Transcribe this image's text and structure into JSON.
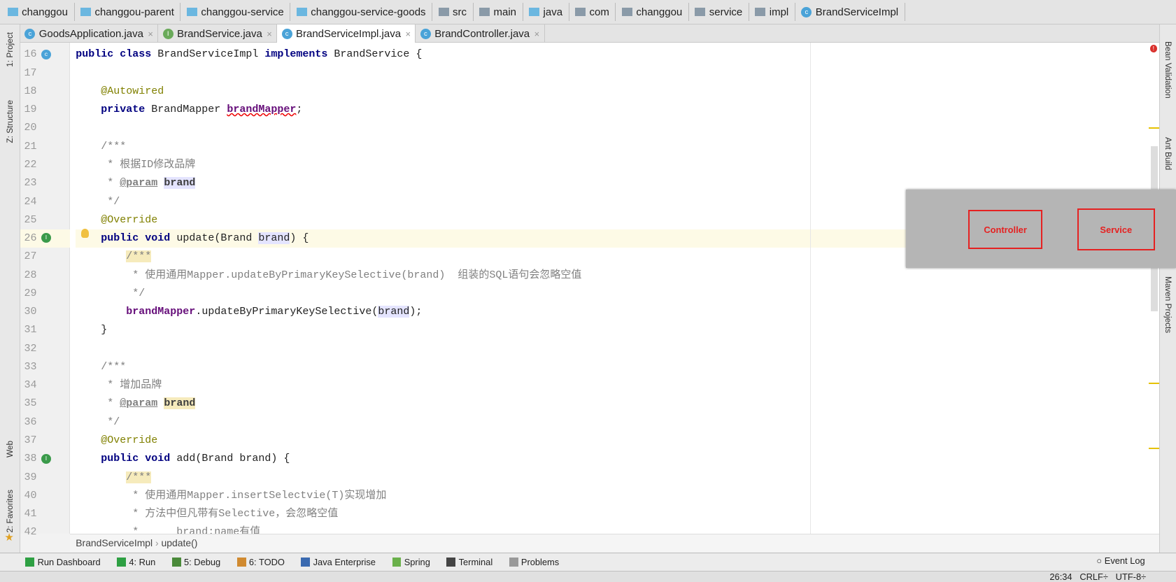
{
  "breadcrumb": [
    {
      "label": "changgou",
      "icon": "module-folder"
    },
    {
      "label": "changgou-parent",
      "icon": "module-folder"
    },
    {
      "label": "changgou-service",
      "icon": "module-folder"
    },
    {
      "label": "changgou-service-goods",
      "icon": "module-folder"
    },
    {
      "label": "src",
      "icon": "folder"
    },
    {
      "label": "main",
      "icon": "folder"
    },
    {
      "label": "java",
      "icon": "source-folder"
    },
    {
      "label": "com",
      "icon": "package"
    },
    {
      "label": "changgou",
      "icon": "package"
    },
    {
      "label": "service",
      "icon": "package"
    },
    {
      "label": "impl",
      "icon": "package"
    },
    {
      "label": "BrandServiceImpl",
      "icon": "class"
    }
  ],
  "tabs": [
    {
      "label": "GoodsApplication.java",
      "icon": "spring-boot-class",
      "active": false,
      "color": "#4aa3d8"
    },
    {
      "label": "BrandService.java",
      "icon": "interface",
      "active": false,
      "color": "#6aaa5a"
    },
    {
      "label": "BrandServiceImpl.java",
      "icon": "class",
      "active": true,
      "color": "#4aa3d8"
    },
    {
      "label": "BrandController.java",
      "icon": "class",
      "active": false,
      "color": "#4aa3d8"
    }
  ],
  "left_tools": {
    "project": "1: Project",
    "structure": "Z: Structure",
    "web": "Web",
    "favorites": "2: Favorites"
  },
  "right_tools": {
    "bean": "Bean Validation",
    "ant": "Ant Build",
    "maven": "Maven Projects"
  },
  "code": [
    {
      "n": "16",
      "tokens": [
        [
          "kw",
          "public class "
        ],
        [
          "",
          "BrandServiceImpl "
        ],
        [
          "kw",
          "implements "
        ],
        [
          "",
          "BrandService {"
        ]
      ]
    },
    {
      "n": "17",
      "tokens": []
    },
    {
      "n": "18",
      "tokens": [
        [
          "",
          "    "
        ],
        [
          "an",
          "@Autowired"
        ]
      ]
    },
    {
      "n": "19",
      "tokens": [
        [
          "",
          "    "
        ],
        [
          "kw",
          "private "
        ],
        [
          "",
          "BrandMapper "
        ],
        [
          "fld err",
          "brandMapper"
        ],
        [
          "",
          ";"
        ]
      ]
    },
    {
      "n": "20",
      "tokens": []
    },
    {
      "n": "21",
      "tokens": [
        [
          "",
          "    "
        ],
        [
          "cm",
          "/***"
        ]
      ]
    },
    {
      "n": "22",
      "tokens": [
        [
          "cm",
          "     * 根据ID修改品牌"
        ]
      ]
    },
    {
      "n": "23",
      "tokens": [
        [
          "cm",
          "     * "
        ],
        [
          "cmt",
          "@param"
        ],
        [
          "cm",
          " "
        ],
        [
          "cmb hl",
          "brand"
        ]
      ]
    },
    {
      "n": "24",
      "tokens": [
        [
          "cm",
          "     */"
        ]
      ]
    },
    {
      "n": "25",
      "tokens": [
        [
          "",
          "    "
        ],
        [
          "an",
          "@Override"
        ]
      ]
    },
    {
      "n": "26",
      "tokens": [
        [
          "",
          "    "
        ],
        [
          "kw",
          "public void "
        ],
        [
          "",
          "update(Brand "
        ],
        [
          "hl",
          "brand"
        ],
        [
          "",
          ") {"
        ]
      ],
      "current": true
    },
    {
      "n": "27",
      "tokens": [
        [
          "",
          "        "
        ],
        [
          "cm hy",
          "/***"
        ]
      ]
    },
    {
      "n": "28",
      "tokens": [
        [
          "cm",
          "         * 使用通用Mapper.updateByPrimaryKeySelective(brand)  组装的SQL语句会忽略空值"
        ]
      ]
    },
    {
      "n": "29",
      "tokens": [
        [
          "cm",
          "         */"
        ]
      ]
    },
    {
      "n": "30",
      "tokens": [
        [
          "",
          "        "
        ],
        [
          "fld",
          "brandMapper"
        ],
        [
          "",
          ".updateByPrimaryKeySelective("
        ],
        [
          "hl",
          "brand"
        ],
        [
          "",
          ");"
        ]
      ]
    },
    {
      "n": "31",
      "tokens": [
        [
          "",
          "    }"
        ]
      ]
    },
    {
      "n": "32",
      "tokens": []
    },
    {
      "n": "33",
      "tokens": [
        [
          "",
          "    "
        ],
        [
          "cm",
          "/***"
        ]
      ]
    },
    {
      "n": "34",
      "tokens": [
        [
          "cm",
          "     * 增加品牌"
        ]
      ]
    },
    {
      "n": "35",
      "tokens": [
        [
          "cm",
          "     * "
        ],
        [
          "cmt",
          "@param"
        ],
        [
          "cm",
          " "
        ],
        [
          "cmb hy",
          "brand"
        ]
      ]
    },
    {
      "n": "36",
      "tokens": [
        [
          "cm",
          "     */"
        ]
      ]
    },
    {
      "n": "37",
      "tokens": [
        [
          "",
          "    "
        ],
        [
          "an",
          "@Override"
        ]
      ]
    },
    {
      "n": "38",
      "tokens": [
        [
          "",
          "    "
        ],
        [
          "kw",
          "public void "
        ],
        [
          "",
          "add(Brand brand) {"
        ]
      ]
    },
    {
      "n": "39",
      "tokens": [
        [
          "",
          "        "
        ],
        [
          "cm hy",
          "/***"
        ]
      ]
    },
    {
      "n": "40",
      "tokens": [
        [
          "cm",
          "         * 使用通用Mapper.insertSelectvie(T)实现增加"
        ]
      ]
    },
    {
      "n": "41",
      "tokens": [
        [
          "cm",
          "         * 方法中但凡带有Selective，会忽略空值"
        ]
      ]
    },
    {
      "n": "42",
      "tokens": [
        [
          "cm",
          "         *      brand:name有值"
        ]
      ]
    }
  ],
  "editor_breadcrumb": {
    "cls": "BrandServiceImpl",
    "method": "update()"
  },
  "overlay": {
    "controller": "Controller",
    "service": "Service"
  },
  "toolwindows": [
    {
      "label": "Run Dashboard",
      "icon": "run-icon",
      "color": "#2ea043"
    },
    {
      "label": "4: Run",
      "icon": "run-icon",
      "color": "#2ea043"
    },
    {
      "label": "5: Debug",
      "icon": "debug-icon",
      "color": "#4a8a3a"
    },
    {
      "label": "6: TODO",
      "icon": "todo-icon",
      "color": "#d08a30"
    },
    {
      "label": "Java Enterprise",
      "icon": "java-enterprise-icon",
      "color": "#3a6ab0"
    },
    {
      "label": "Spring",
      "icon": "spring-icon",
      "color": "#6ab04a"
    },
    {
      "label": "Terminal",
      "icon": "terminal-icon",
      "color": "#444444"
    },
    {
      "label": "Problems",
      "icon": "problems-icon",
      "color": "#999999"
    }
  ],
  "event_log": "Event Log",
  "status": {
    "position": "26:34",
    "line_sep": "CRLF÷",
    "encoding": "UTF-8÷"
  }
}
